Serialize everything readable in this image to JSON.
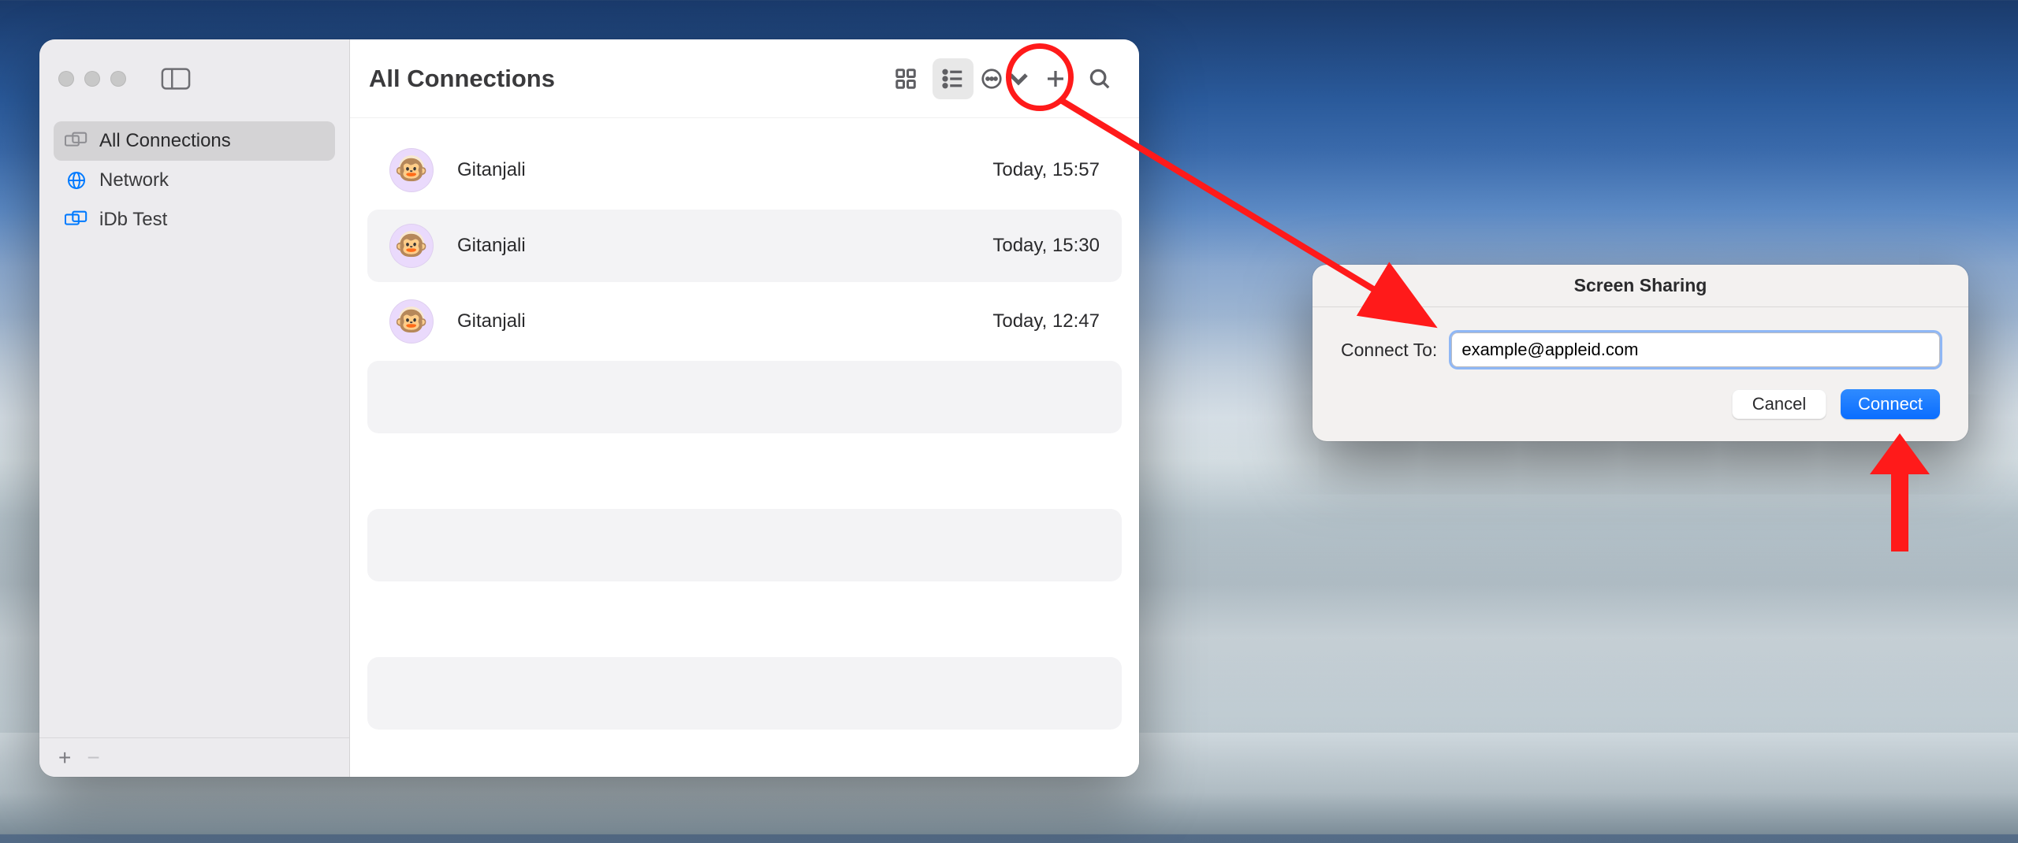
{
  "window": {
    "sidebar": {
      "items": [
        {
          "label": "All Connections",
          "icon": "screens-icon",
          "active": true
        },
        {
          "label": "Network",
          "icon": "globe-icon",
          "active": false
        },
        {
          "label": "iDb Test",
          "icon": "windows-icon",
          "active": false
        }
      ],
      "footer_add": "+",
      "footer_remove": "−"
    },
    "toolbar": {
      "title": "All Connections"
    },
    "rows": [
      {
        "avatar": "🐵",
        "name": "Gitanjali",
        "time": "Today, 15:57",
        "alt": false
      },
      {
        "avatar": "🐵",
        "name": "Gitanjali",
        "time": "Today, 15:30",
        "alt": true
      },
      {
        "avatar": "🐵",
        "name": "Gitanjali",
        "time": "Today, 12:47",
        "alt": false
      }
    ]
  },
  "dialog": {
    "title": "Screen Sharing",
    "label": "Connect To:",
    "value": "example@appleid.com",
    "cancel": "Cancel",
    "connect": "Connect"
  }
}
